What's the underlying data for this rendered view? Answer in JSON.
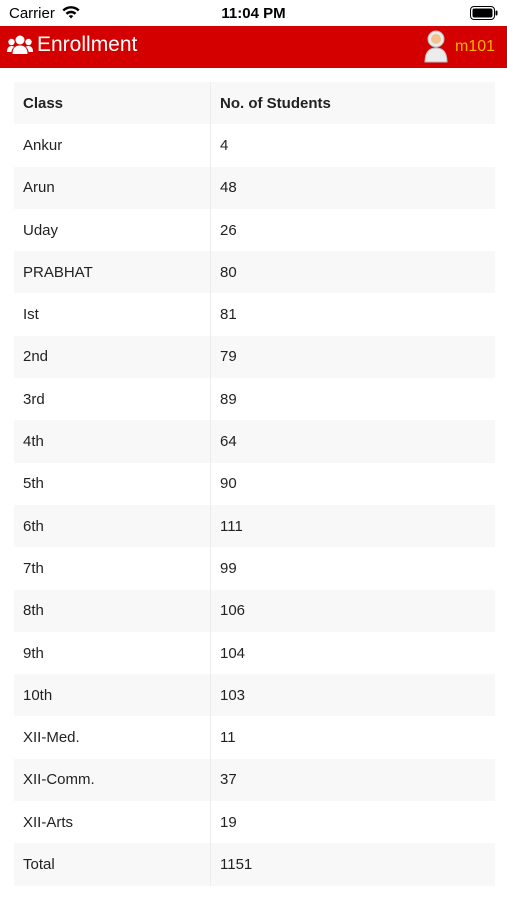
{
  "status_bar": {
    "carrier": "Carrier",
    "time": "11:04 PM"
  },
  "header": {
    "title": "Enrollment",
    "user": "m101",
    "icon": "users-icon",
    "avatar": "avatar-icon",
    "background_color": "#d40000",
    "user_color": "#ffb300"
  },
  "table": {
    "columns": [
      "Class",
      "No. of Students"
    ],
    "rows": [
      {
        "class": "Ankur",
        "students": "4"
      },
      {
        "class": "Arun",
        "students": "48"
      },
      {
        "class": "Uday",
        "students": "26"
      },
      {
        "class": "PRABHAT",
        "students": "80"
      },
      {
        "class": "Ist",
        "students": "81"
      },
      {
        "class": "2nd",
        "students": "79"
      },
      {
        "class": "3rd",
        "students": "89"
      },
      {
        "class": "4th",
        "students": "64"
      },
      {
        "class": "5th",
        "students": "90"
      },
      {
        "class": "6th",
        "students": "111"
      },
      {
        "class": "7th",
        "students": "99"
      },
      {
        "class": "8th",
        "students": "106"
      },
      {
        "class": "9th",
        "students": "104"
      },
      {
        "class": "10th",
        "students": "103"
      },
      {
        "class": "XII-Med.",
        "students": "11"
      },
      {
        "class": "XII-Comm.",
        "students": "37"
      },
      {
        "class": "XII-Arts",
        "students": "19"
      },
      {
        "class": "Total",
        "students": "1151"
      }
    ]
  }
}
